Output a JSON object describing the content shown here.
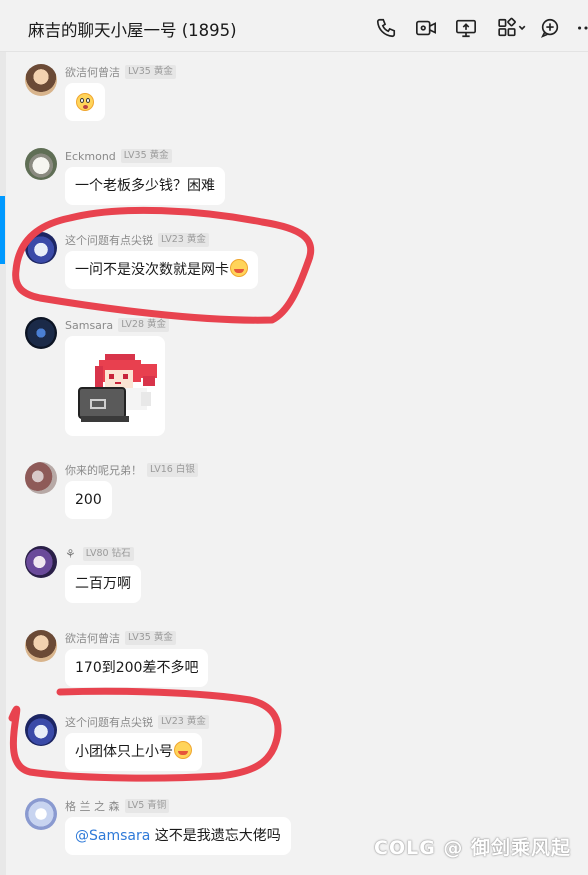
{
  "header": {
    "title": "麻吉的聊天小屋一号 (1895)"
  },
  "toolbar": {
    "icons": [
      "phone-icon",
      "video-call-icon",
      "screen-share-icon",
      "apps-icon",
      "add-member-icon",
      "more-icon"
    ]
  },
  "messages": [
    {
      "nick": "欲洁何曾洁",
      "badge": "LV35 黄金",
      "text": ""
    },
    {
      "nick": "Eckmond",
      "badge": "LV35 黄金",
      "text": "一个老板多少钱？困难"
    },
    {
      "nick": "这个问题有点尖锐",
      "badge": "LV23 黄金",
      "text": "一问不是没次数就是网卡"
    },
    {
      "nick": "Samsara",
      "badge": "LV28 黄金",
      "text": ""
    },
    {
      "nick": "你来的呢兄弟！",
      "badge": "LV16 白银",
      "text": "200"
    },
    {
      "nick": "",
      "badge": "LV80 钻石",
      "text": "二百万啊"
    },
    {
      "nick": "欲洁何曾洁",
      "badge": "LV35 黄金",
      "text": "170到200差不多吧"
    },
    {
      "nick": "这个问题有点尖锐",
      "badge": "LV23 黄金",
      "text": "小团体只上小号"
    },
    {
      "nick": "格 兰 之 森",
      "badge": "LV5 青铜",
      "mention": "@Samsara",
      "text": "这不是我遗忘大佬吗"
    }
  ],
  "watermark": "COLG @ 御剑乘风起",
  "colors": {
    "accent": "#0099ff",
    "highlight_circle": "#e8434f",
    "bubble": "#ffffff",
    "background": "#f2f2f2"
  }
}
